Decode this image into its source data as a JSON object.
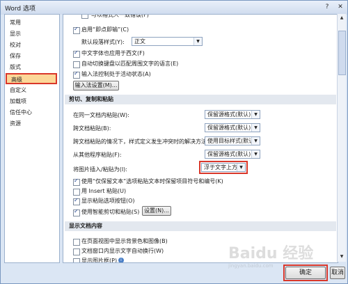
{
  "window": {
    "title": "Word 选项",
    "help_icon": "?",
    "close_icon": "✕"
  },
  "sidebar": {
    "items": [
      {
        "label": "常用"
      },
      {
        "label": "显示"
      },
      {
        "label": "校对"
      },
      {
        "label": "保存"
      },
      {
        "label": "版式"
      },
      {
        "label": "高级"
      },
      {
        "label": "自定义"
      },
      {
        "label": "加载项"
      },
      {
        "label": "信任中心"
      },
      {
        "label": "资源"
      }
    ]
  },
  "editing": {
    "top_cut": "与以格式人一致错误(F)",
    "enable_click_type": "启用“即点即输”(C)",
    "default_style_label": "默认段落样式(Y):",
    "default_style_value": "正文",
    "zh_font_western": "中文字体也应用于西文(F)",
    "auto_switch_kb": "自动切换键盘以匹配周围文字的语言(E)",
    "ime_active": "输入法控制处于活动状态(A)",
    "ime_settings_btn": "输入法设置(M)..."
  },
  "paste": {
    "section_title": "剪切、复制和粘贴",
    "rows": [
      {
        "label": "在同一文档内粘贴(W):",
        "value": "保留源格式(默认)"
      },
      {
        "label": "跨文档粘贴(B):",
        "value": "保留源格式(默认)"
      },
      {
        "label": "跨文档粘贴的情况下，样式定义发生冲突时的解决方法(E):",
        "value": "使用目标样式(默认)"
      },
      {
        "label": "从其他程序粘贴(F):",
        "value": "保留源格式(默认)"
      },
      {
        "label": "将图片插入/粘贴为(I):",
        "value": "浮于文字上方"
      }
    ],
    "keep_bullets": "使用“仅保留文本”选项粘贴文本时保留项目符号和编号(K)",
    "insert_key": "用 Insert 粘贴(U)",
    "show_paste_options": "显示粘贴选项按钮(O)",
    "smart_cut": "使用智能剪切和粘贴(S)",
    "settings_btn": "设置(N)..."
  },
  "display": {
    "section_title": "显示文档内容",
    "show_bg": "在页面视图中显示背景色和图像(B)",
    "wrap_text": "文档窗口内显示文字自动换行(W)",
    "show_placeholders": "显示图片框(P)"
  },
  "footer": {
    "ok": "确定",
    "cancel": "取消"
  },
  "watermark": {
    "text": "Baidu 经验",
    "sub": "jingyan.baidu.com"
  }
}
